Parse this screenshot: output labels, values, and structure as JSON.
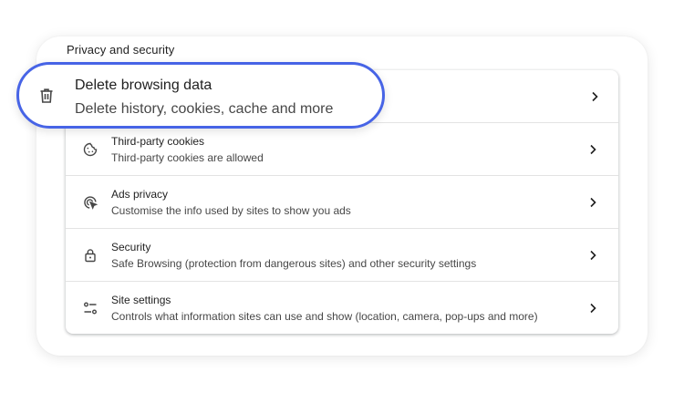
{
  "section": {
    "title": "Privacy and security"
  },
  "highlighted_item": {
    "title": "Delete browsing data",
    "subtitle": "Delete history, cookies, cache and more",
    "icon": "trash-icon",
    "highlight_color": "#4764e6"
  },
  "items": [
    {
      "title": "Third-party cookies",
      "subtitle": "Third-party cookies are allowed",
      "icon": "cookie-icon"
    },
    {
      "title": "Ads privacy",
      "subtitle": "Customise the info used by sites to show you ads",
      "icon": "ads-click-icon"
    },
    {
      "title": "Security",
      "subtitle": "Safe Browsing (protection from dangerous sites) and other security settings",
      "icon": "lock-icon"
    },
    {
      "title": "Site settings",
      "subtitle": "Controls what information sites can use and show (location, camera, pop-ups and more)",
      "icon": "tune-icon"
    }
  ]
}
